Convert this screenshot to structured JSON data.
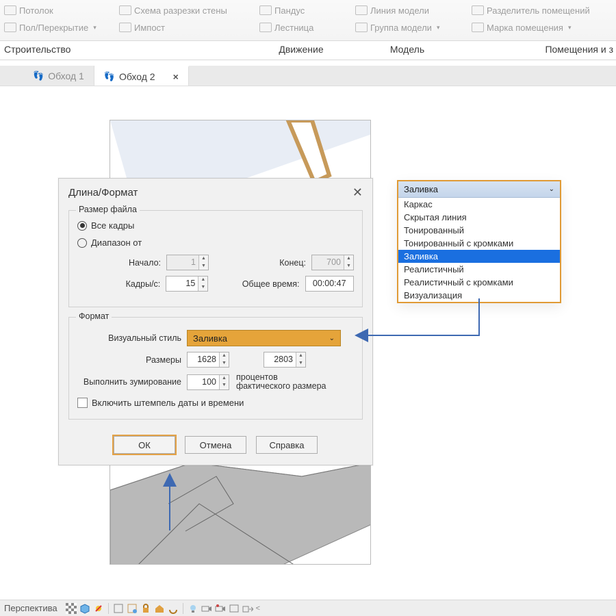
{
  "ribbon": {
    "group1": {
      "ceiling": "Потолок",
      "floor": "Пол/Перекрытие",
      "section1_label": "Строительство"
    },
    "group2": {
      "wall_scheme": "Схема разрезки стены",
      "impost": "Импост"
    },
    "group3": {
      "ramp": "Пандус",
      "stair": "Лестница",
      "section_label": "Движение"
    },
    "group4": {
      "model_line": "Линия  модели",
      "model_group": "Группа модели",
      "section_label": "Модель"
    },
    "group5": {
      "room_sep": "Разделитель помещений",
      "room_tag": "Марка помещения",
      "section_label": "Помещения и з"
    }
  },
  "tabs": {
    "tab1": "Обход 1",
    "tab2": "Обход 2"
  },
  "dialog": {
    "title": "Длина/Формат",
    "file_size_legend": "Размер файла",
    "all_frames": "Все кадры",
    "range_from": "Диапазон от",
    "start_label": "Начало:",
    "start_value": "1",
    "end_label": "Конец:",
    "end_value": "700",
    "fps_label": "Кадры/с:",
    "fps_value": "15",
    "total_time_label": "Общее время:",
    "total_time_value": "00:00:47",
    "format_legend": "Формат",
    "visual_style_label": "Визуальный стиль",
    "visual_style_value": "Заливка",
    "dim_label": "Размеры",
    "dim_w": "1628",
    "dim_h": "2803",
    "zoom_label": "Выполнить зумирование",
    "zoom_value": "100",
    "zoom_suffix1": "процентов",
    "zoom_suffix2": "фактического размера",
    "timestamp_label": "Включить штемпель даты и времени",
    "ok": "ОК",
    "cancel": "Отмена",
    "help": "Справка"
  },
  "dropdown": {
    "header": "Заливка",
    "options": [
      "Каркас",
      "Скрытая линия",
      "Тонированный",
      "Тонированный с кромками",
      "Заливка",
      "Реалистичный",
      "Реалистичный с кромками",
      "Визуализация"
    ],
    "selected_index": 4
  },
  "status": {
    "label": "Перспектива"
  }
}
